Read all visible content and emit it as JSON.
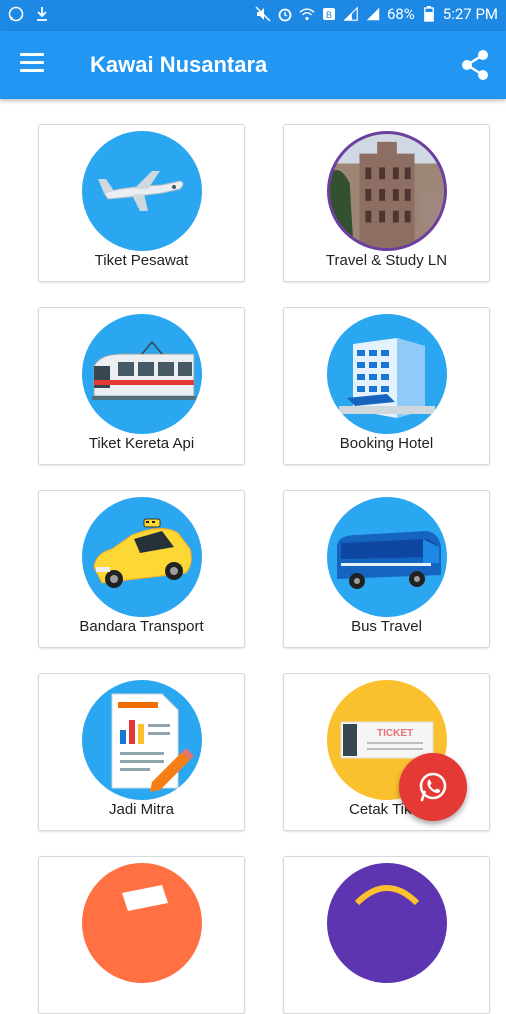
{
  "statusbar": {
    "battery": "68%",
    "time": "5:27 PM"
  },
  "appbar": {
    "title": "Kawai Nusantara"
  },
  "menu": [
    {
      "label": "Tiket Pesawat",
      "icon": "airplane-icon",
      "color": "#2aa7f0"
    },
    {
      "label": "Travel & Study LN",
      "icon": "building-photo-icon",
      "color": "#6a3fa0"
    },
    {
      "label": "Tiket Kereta Api",
      "icon": "train-icon",
      "color": "#2aa7f0"
    },
    {
      "label": "Booking Hotel",
      "icon": "hotel-icon",
      "color": "#2aa7f0"
    },
    {
      "label": "Bandara Transport",
      "icon": "taxi-icon",
      "color": "#2aa7f0"
    },
    {
      "label": "Bus Travel",
      "icon": "bus-icon",
      "color": "#2aa7f0"
    },
    {
      "label": "Jadi Mitra",
      "icon": "document-chart-icon",
      "color": "#2aa7f0"
    },
    {
      "label": "Cetak Tiket",
      "icon": "ticket-icon",
      "color": "#fbc02d"
    },
    {
      "label": "",
      "icon": "partial-item-icon",
      "color": "#ff7043"
    },
    {
      "label": "",
      "icon": "partial-item-icon",
      "color": "#5e35b1"
    }
  ],
  "fab": {
    "icon": "whatsapp-icon",
    "color": "#e53935"
  }
}
